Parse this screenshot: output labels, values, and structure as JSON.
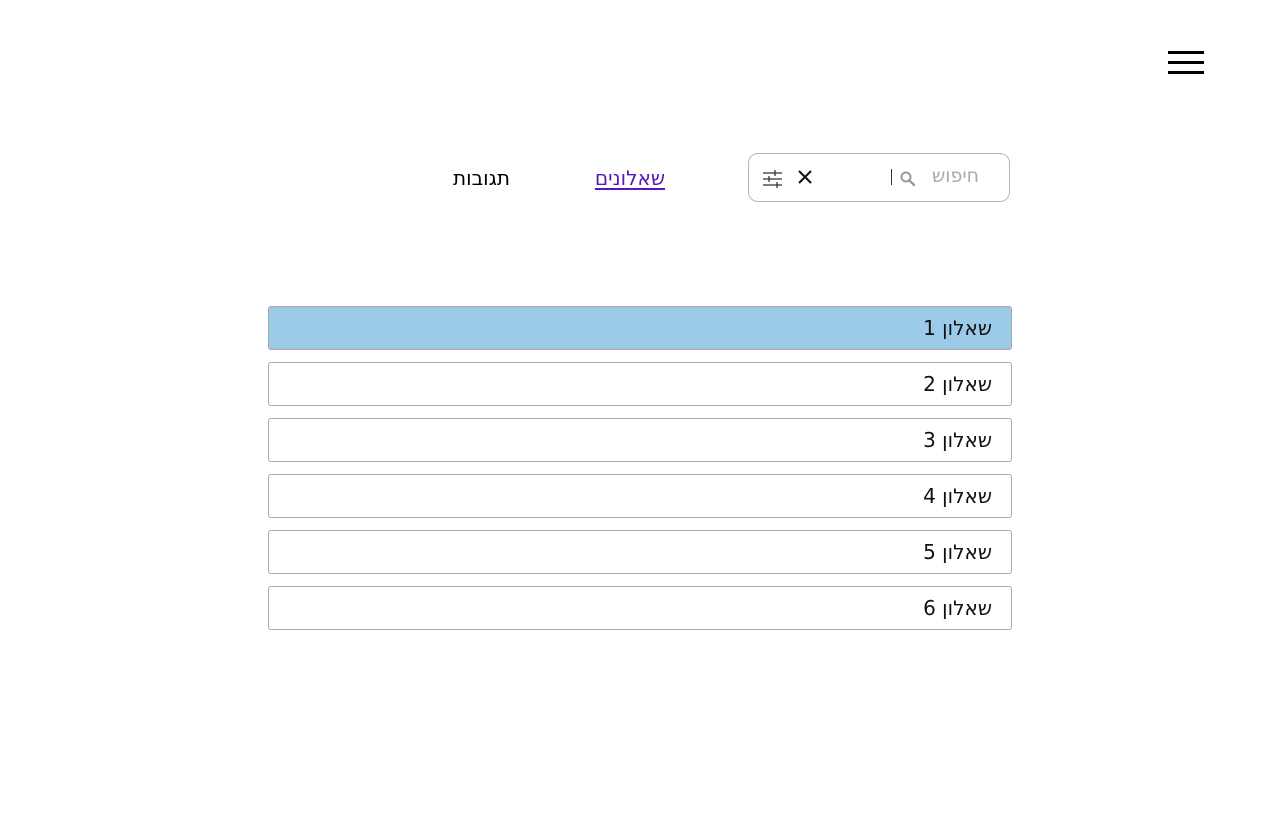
{
  "header": {
    "menu_icon": "hamburger-menu-icon"
  },
  "search": {
    "placeholder": "חיפוש",
    "icons": [
      "search-icon",
      "clear-icon",
      "filter-sliders-icon"
    ]
  },
  "tabs": [
    {
      "label": "שאלונים",
      "active": true
    },
    {
      "label": "תגובות",
      "active": false
    }
  ],
  "questionnaires": [
    {
      "label": "שאלון 1",
      "selected": true
    },
    {
      "label": "שאלון 2",
      "selected": false
    },
    {
      "label": "שאלון 3",
      "selected": false
    },
    {
      "label": "שאלון 4",
      "selected": false
    },
    {
      "label": "שאלון 5",
      "selected": false
    },
    {
      "label": "שאלון 6",
      "selected": false
    }
  ],
  "colors": {
    "selected_row": "#9ccbe9",
    "active_tab": "#5a17b8",
    "border": "#a9a9a9"
  }
}
